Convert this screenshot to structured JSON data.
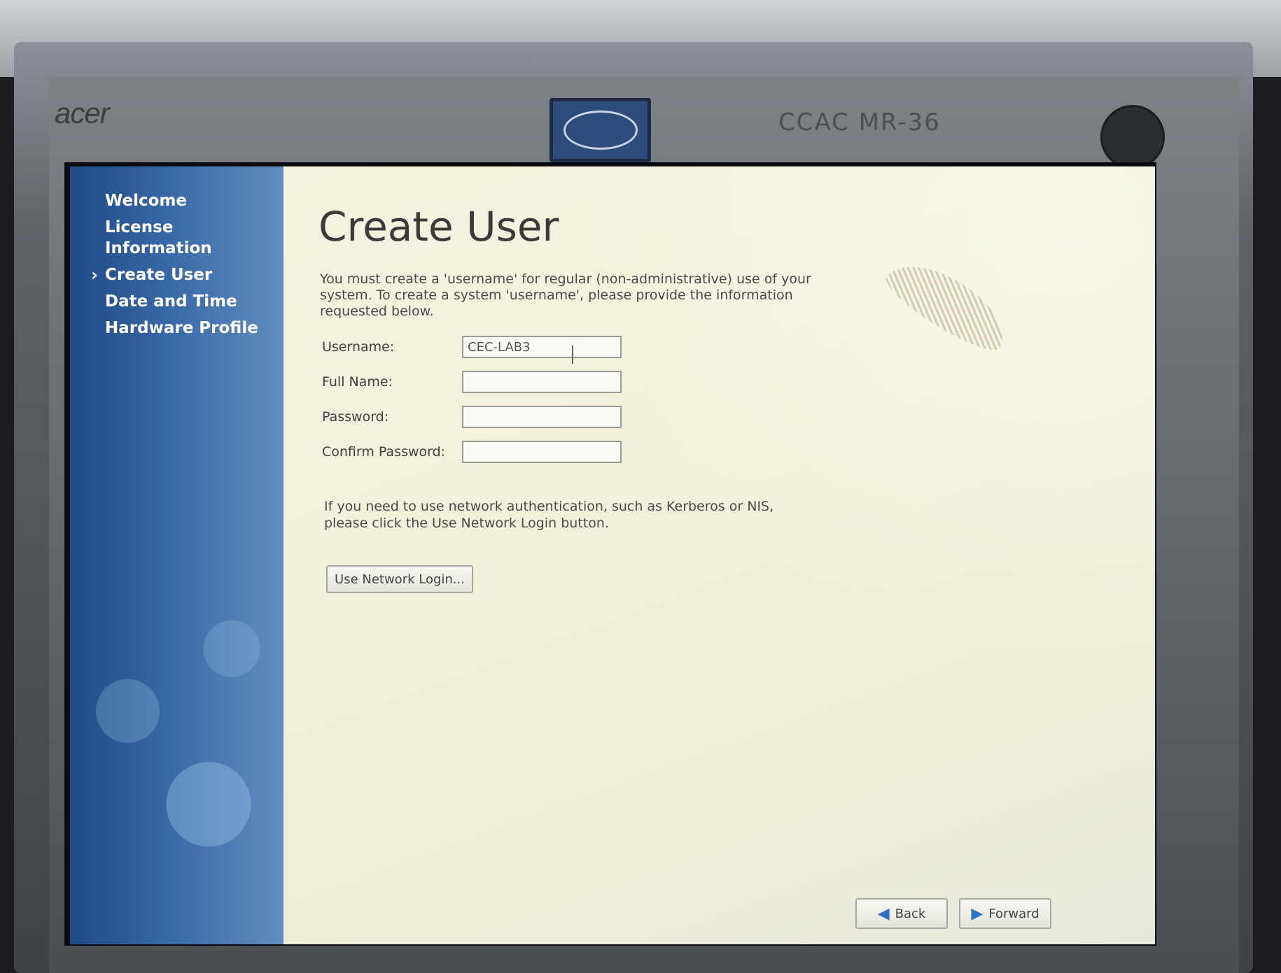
{
  "monitor": {
    "brand": "acer",
    "marker_note": "CCAC MR-36"
  },
  "sidebar": {
    "items": [
      {
        "label": "Welcome",
        "active": false
      },
      {
        "label": "License Information",
        "active": false
      },
      {
        "label": "Create User",
        "active": true
      },
      {
        "label": "Date and Time",
        "active": false
      },
      {
        "label": "Hardware Profile",
        "active": false
      }
    ]
  },
  "main": {
    "title": "Create User",
    "intro": "You must create a 'username' for regular (non-administrative) use of your system. To create a system 'username', please provide the information requested below.",
    "fields": {
      "username": {
        "label": "Username:",
        "value": "CEC-LAB3"
      },
      "full_name": {
        "label": "Full Name:",
        "value": ""
      },
      "password": {
        "label": "Password:",
        "value": ""
      },
      "confirm_password": {
        "label": "Confirm Password:",
        "value": ""
      }
    },
    "network_note": "If you need to use network authentication, such as Kerberos or NIS, please click the Use Network Login button.",
    "network_button": "Use Network Login..."
  },
  "footer": {
    "back_label": "Back",
    "forward_label": "Forward"
  },
  "icons": {
    "back": "arrow-left-icon",
    "forward": "arrow-right-icon"
  },
  "colors": {
    "sidebar_blue": "#2f5e9c",
    "content_bg": "#f3f1da",
    "arrow_blue": "#2f6fc0"
  }
}
